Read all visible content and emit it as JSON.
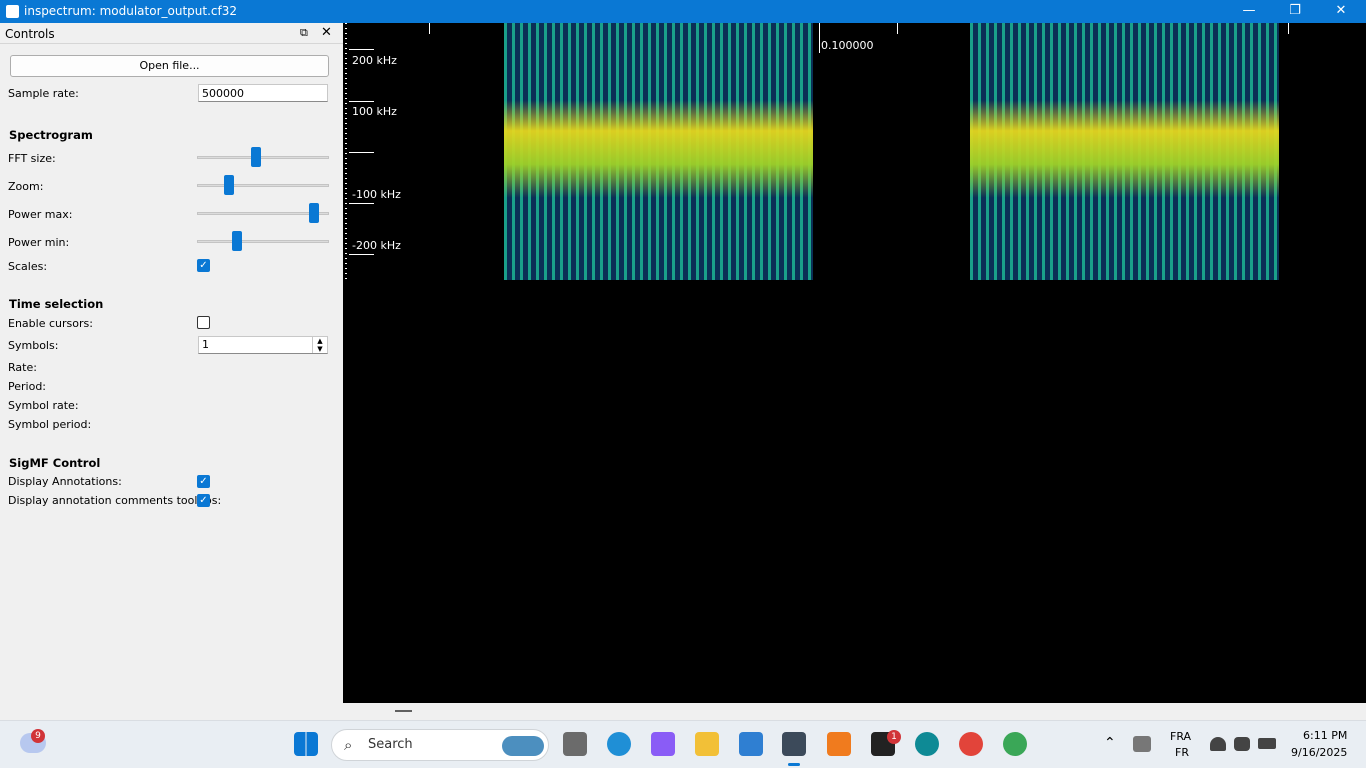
{
  "window": {
    "title": "inspectrum: modulator_output.cf32",
    "minimize_glyph": "—",
    "restore_glyph": "❐",
    "close_glyph": "✕"
  },
  "controls": {
    "dock_title": "Controls",
    "float_glyph": "⧉",
    "close_glyph": "✕",
    "open_file_label": "Open file...",
    "sample_rate_label": "Sample rate:",
    "sample_rate_value": "500000",
    "spectrogram_heading": "Spectrogram",
    "fft_size_label": "FFT size:",
    "fft_size_level": 0.44,
    "zoom_label": "Zoom:",
    "zoom_level": 0.22,
    "power_max_label": "Power max:",
    "power_max_level": 0.92,
    "power_min_label": "Power min:",
    "power_min_level": 0.29,
    "scales_label": "Scales:",
    "scales_checked": true,
    "time_selection_heading": "Time selection",
    "enable_cursors_label": "Enable cursors:",
    "enable_cursors_checked": false,
    "symbols_label": "Symbols:",
    "symbols_value": "1",
    "rate_label": "Rate:",
    "period_label": "Period:",
    "symbol_rate_label": "Symbol rate:",
    "symbol_period_label": "Symbol period:",
    "sigmf_heading": "SigMF Control",
    "display_annotations_label": "Display Annotations:",
    "display_annotations_checked": true,
    "display_tooltips_label": "Display annotation comments tooltips:",
    "display_tooltips_checked": true,
    "check_glyph": "✓"
  },
  "spectrogram": {
    "freq_labels": [
      "200 kHz",
      "100 kHz",
      "-100 kHz",
      "-200 kHz"
    ],
    "time_label": "0.100000"
  },
  "taskbar": {
    "weather_badge": "9",
    "search_label": "Search",
    "notion_badge": "1",
    "lang_top": "FRA",
    "lang_bottom": "FR",
    "time": "6:11 PM",
    "date": "9/16/2025",
    "chevron_glyph": "⌃"
  }
}
